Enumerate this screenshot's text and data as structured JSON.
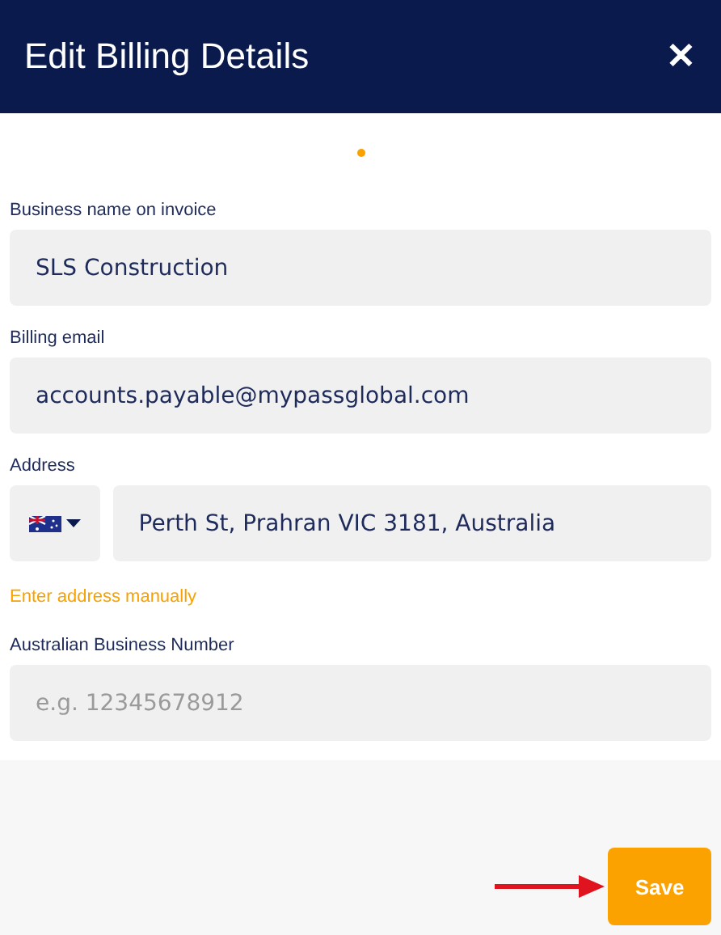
{
  "dialog": {
    "title": "Edit Billing Details",
    "close": "✕"
  },
  "fields": [
    {
      "kind": "text",
      "label": "Business name on invoice",
      "value": "SLS Construction"
    },
    {
      "kind": "text",
      "label": "Billing email",
      "value": "accounts.payable@mypassglobal.com"
    },
    {
      "kind": "address",
      "label": "Address",
      "value": "Perth St, Prahran VIC 3181, Australia",
      "link": "Enter address manually"
    },
    {
      "kind": "text",
      "label": "Australian Business Number",
      "placeholder": "e.g. 12345678912"
    }
  ],
  "footer": {
    "button": "Save",
    "arrow": true
  }
}
